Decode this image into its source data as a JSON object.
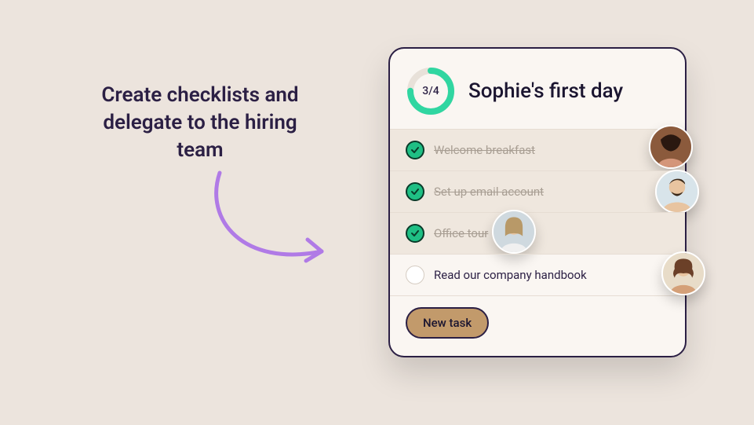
{
  "headline": "Create checklists and delegate to the hiring team",
  "card": {
    "title": "Sophie's first day",
    "progress_label": "3/4",
    "progress_done": 3,
    "progress_total": 4,
    "new_task_label": "New task"
  },
  "tasks": [
    {
      "label": "Welcome breakfast",
      "done": true
    },
    {
      "label": "Set up email account",
      "done": true
    },
    {
      "label": "Office tour",
      "done": true
    },
    {
      "label": "Read our company handbook",
      "done": false
    }
  ],
  "colors": {
    "accent_green": "#30d6a1",
    "accent_purple": "#b07ae6",
    "button_fill": "#c29a6b"
  }
}
